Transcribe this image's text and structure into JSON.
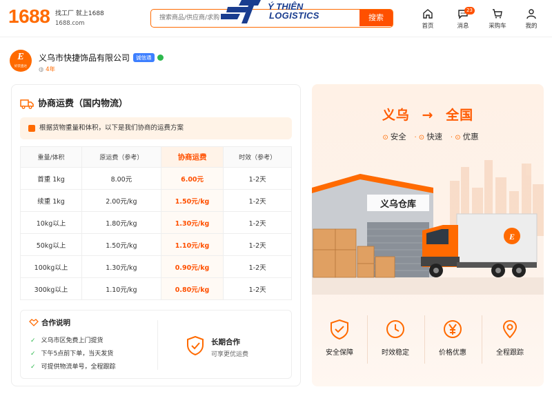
{
  "header": {
    "logo": "1688",
    "tagline_line1": "找工厂  就上1688",
    "tagline_line2": "1688.com",
    "search_placeholder": "搜索商品/供应商/求购",
    "search_button": "搜索",
    "watermark_line1": "Ý THIÊN",
    "watermark_line2": "LOGISTICS",
    "nav": [
      {
        "label": "首页",
        "icon": "home-icon"
      },
      {
        "label": "消息",
        "icon": "message-icon",
        "badge": "23"
      },
      {
        "label": "采购车",
        "icon": "cart-icon"
      },
      {
        "label": "我的",
        "icon": "user-icon"
      }
    ]
  },
  "company": {
    "name": "义乌市快捷饰品有限公司",
    "cert_badge": "诚信通",
    "years": "4年",
    "logo_text": "E",
    "logo_sub": "好货直达"
  },
  "shipping": {
    "title": "协商运费（国内物流）",
    "notice": "根据货物重量和体积，以下是我们协商的运费方案",
    "columns": [
      "重量/体积",
      "原运费（参考）",
      "协商运费",
      "时效（参考）"
    ],
    "rows": [
      [
        "首重 1kg",
        "8.00元",
        "6.00元",
        "1-2天"
      ],
      [
        "续重 1kg",
        "2.00元/kg",
        "1.50元/kg",
        "1-2天"
      ],
      [
        "10kg以上",
        "1.80元/kg",
        "1.30元/kg",
        "1-2天"
      ],
      [
        "50kg以上",
        "1.50元/kg",
        "1.10元/kg",
        "1-2天"
      ],
      [
        "100kg以上",
        "1.30元/kg",
        "0.90元/kg",
        "1-2天"
      ],
      [
        "300kg以上",
        "1.10元/kg",
        "0.80元/kg",
        "1-2天"
      ]
    ]
  },
  "cooperation": {
    "title": "合作说明",
    "items": [
      "义乌市区免费上门提货",
      "下午5点前下单，当天发货",
      "可提供物流单号，全程跟踪"
    ],
    "long_term_title": "长期合作",
    "long_term_sub": "可享更优运费"
  },
  "banner": {
    "route_from": "义乌",
    "route_arrow": "→",
    "route_to": "全国",
    "tags": [
      "安全",
      "快速",
      "优惠"
    ],
    "warehouse_sign": "义乌仓库",
    "features": [
      {
        "label": "安全保障",
        "icon": "shield-icon"
      },
      {
        "label": "时效稳定",
        "icon": "clock-icon"
      },
      {
        "label": "价格优惠",
        "icon": "yen-icon"
      },
      {
        "label": "全程跟踪",
        "icon": "location-icon"
      }
    ]
  },
  "colors": {
    "accent": "#ff6a00",
    "highlight": "#ff5000",
    "success": "#2db84d",
    "cert": "#3d7fff"
  }
}
